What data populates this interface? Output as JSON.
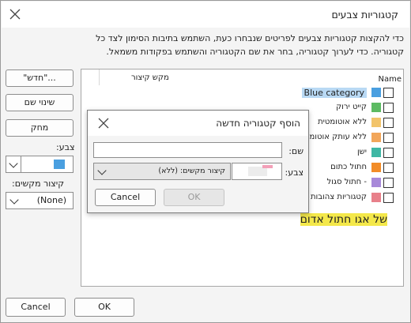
{
  "dialog": {
    "title": "קטגוריות צבעים",
    "description_line1": "כדי להקצות קטגוריות צבעים לפריטים שנבחרו כעת, השתמש בתיבות הסימון לצד כל",
    "description_line2": "קטגוריה.      כדי לערוך קטגוריה, בחר את שם הקטגוריה והשתמש בפקודות משמאל.",
    "ok_label": "OK",
    "cancel_label": "Cancel"
  },
  "side_buttons": {
    "new_label": "\"חדש\"...",
    "rename_label": "שינוי שם",
    "delete_label": "מחק",
    "color_label": "צבע:",
    "color_value": "#4a9fe0",
    "shortcut_label": "קיצור מקשים:",
    "shortcut_value": "(None)"
  },
  "list": {
    "headers": {
      "name": "Name",
      "shortcut": "מקש קיצור"
    },
    "rows": [
      {
        "label": "Blue category",
        "color": "#4a9fe0",
        "checked": false,
        "selected": true
      },
      {
        "label": "קייט ירוק",
        "color": "#5dbb63",
        "checked": false
      },
      {
        "label": "ללא אוטומטית",
        "color": "#f2c46b",
        "checked": false
      },
      {
        "label": "ללא עותק אוטומטי",
        "color": "#f2a65a",
        "checked": false
      },
      {
        "label": "ישן",
        "color": "#3fb7a4",
        "checked": false
      },
      {
        "label": "חתול כתום",
        "color": "#f28c28",
        "checked": false
      },
      {
        "label": "- חתול סגול",
        "color": "#a889d9",
        "checked": false
      },
      {
        "label": "קטגוריות צהובות",
        "color": "#e8808a",
        "checked": false
      }
    ],
    "overlay_text": "של אגו חתול אדום"
  },
  "new_category_dialog": {
    "title": "הוסף קטגוריה חדשה",
    "name_label": "שם:",
    "name_value": "",
    "color_label": "צבע:",
    "shortcut_label": "קיצור מקשים: (ללא)",
    "ok_label": "OK",
    "cancel_label": "Cancel"
  }
}
